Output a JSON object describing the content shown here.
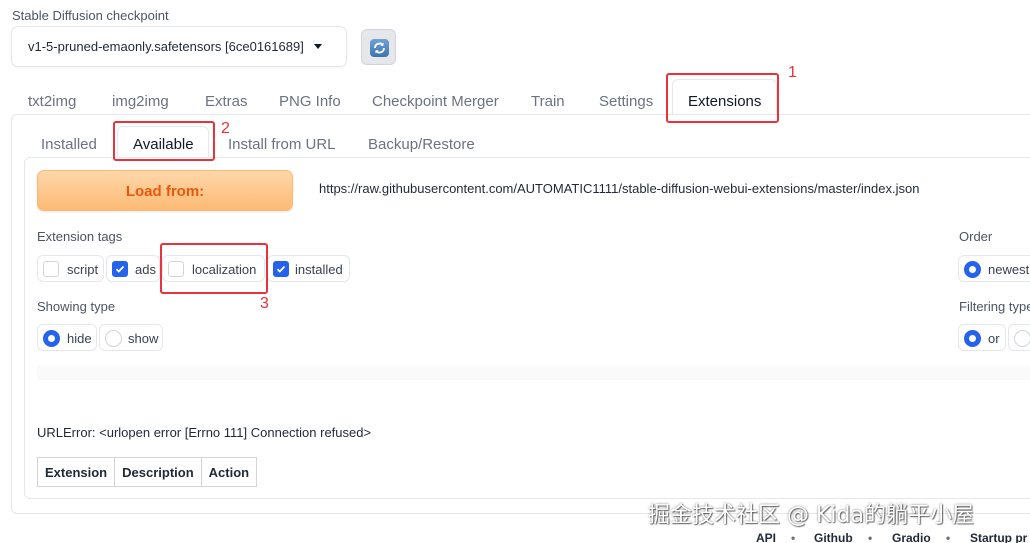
{
  "checkpoint": {
    "label": "Stable Diffusion checkpoint",
    "value": "v1-5-pruned-emaonly.safetensors [6ce0161689]",
    "refresh_icon": "refresh-icon"
  },
  "main_tabs": [
    {
      "label": "txt2img"
    },
    {
      "label": "img2img"
    },
    {
      "label": "Extras"
    },
    {
      "label": "PNG Info"
    },
    {
      "label": "Checkpoint Merger"
    },
    {
      "label": "Train"
    },
    {
      "label": "Settings"
    },
    {
      "label": "Extensions",
      "active": true
    }
  ],
  "sub_tabs": [
    {
      "label": "Installed"
    },
    {
      "label": "Available",
      "active": true
    },
    {
      "label": "Install from URL"
    },
    {
      "label": "Backup/Restore"
    }
  ],
  "load": {
    "button_label": "Load from:",
    "url": "https://raw.githubusercontent.com/AUTOMATIC1111/stable-diffusion-webui-extensions/master/index.json"
  },
  "extension_tags": {
    "label": "Extension tags",
    "options": [
      {
        "label": "script",
        "checked": false
      },
      {
        "label": "ads",
        "checked": true
      },
      {
        "label": "localization",
        "checked": false
      },
      {
        "label": "installed",
        "checked": true
      }
    ]
  },
  "order": {
    "label": "Order",
    "options": [
      {
        "label": "newest",
        "selected": true
      }
    ]
  },
  "showing_type": {
    "label": "Showing type",
    "options": [
      {
        "label": "hide",
        "selected": true
      },
      {
        "label": "show",
        "selected": false
      }
    ]
  },
  "filtering_type": {
    "label": "Filtering type",
    "options": [
      {
        "label": "or",
        "selected": true
      },
      {
        "label": "",
        "selected": false
      }
    ]
  },
  "error_text": "URLError: <urlopen error [Errno 111] Connection refused>",
  "table": {
    "headers": [
      "Extension",
      "Description",
      "Action"
    ]
  },
  "annotations": [
    "1",
    "2",
    "3"
  ],
  "watermark": "掘金技术社区 @ Kida的躺平小屋",
  "footer": {
    "links": [
      "API",
      "Github",
      "Gradio",
      "Startup pr"
    ],
    "separator": "•"
  },
  "colors": {
    "accent": "#2563eb",
    "load_button": "#fdba74",
    "load_text": "#ea580c",
    "highlight": "#e8323c"
  }
}
